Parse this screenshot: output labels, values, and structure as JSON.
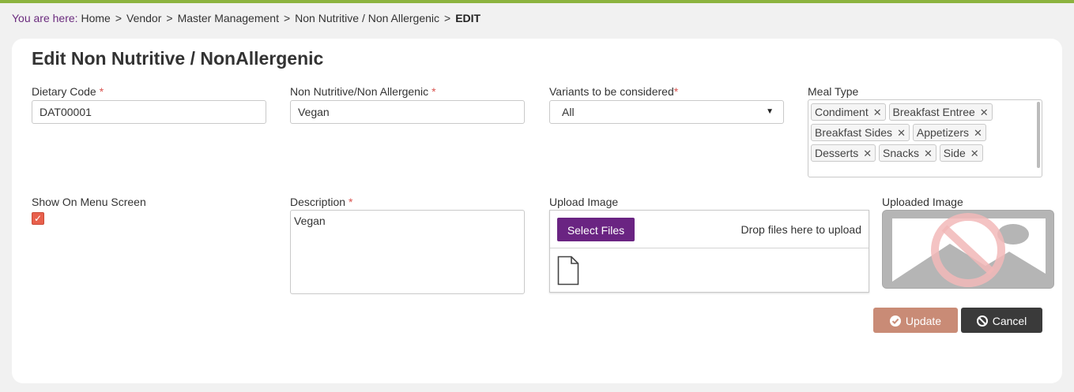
{
  "breadcrumb": {
    "prefix": "You are here:",
    "items": [
      "Home",
      "Vendor",
      "Master Management",
      "Non Nutritive / Non Allergenic"
    ],
    "current": "EDIT"
  },
  "form": {
    "title": "Edit Non Nutritive / NonAllergenic",
    "dietary_code": {
      "label": "Dietary Code",
      "required": "*",
      "value": "DAT00001"
    },
    "name": {
      "label": "Non Nutritive/Non Allergenic",
      "required": "*",
      "value": "Vegan"
    },
    "variants": {
      "label": "Variants to be considered",
      "required": "*",
      "selected": "All"
    },
    "meal_type": {
      "label": "Meal Type",
      "tags": [
        "Condiment",
        "Breakfast Entree",
        "Breakfast Sides",
        "Appetizers",
        "Desserts",
        "Snacks",
        "Side"
      ]
    },
    "show_on_menu": {
      "label": "Show On Menu Screen",
      "checked": true
    },
    "description": {
      "label": "Description",
      "required": "*",
      "value": "Vegan"
    },
    "upload": {
      "label": "Upload Image",
      "button": "Select Files",
      "hint": "Drop files here to upload"
    },
    "uploaded_image": {
      "label": "Uploaded Image"
    },
    "actions": {
      "update": "Update",
      "cancel": "Cancel"
    }
  },
  "colors": {
    "accent_bar": "#8cb33f",
    "primary": "#6a2482",
    "update": "#c98b76",
    "cancel": "#3a3a3a",
    "required": "#d9534f"
  }
}
